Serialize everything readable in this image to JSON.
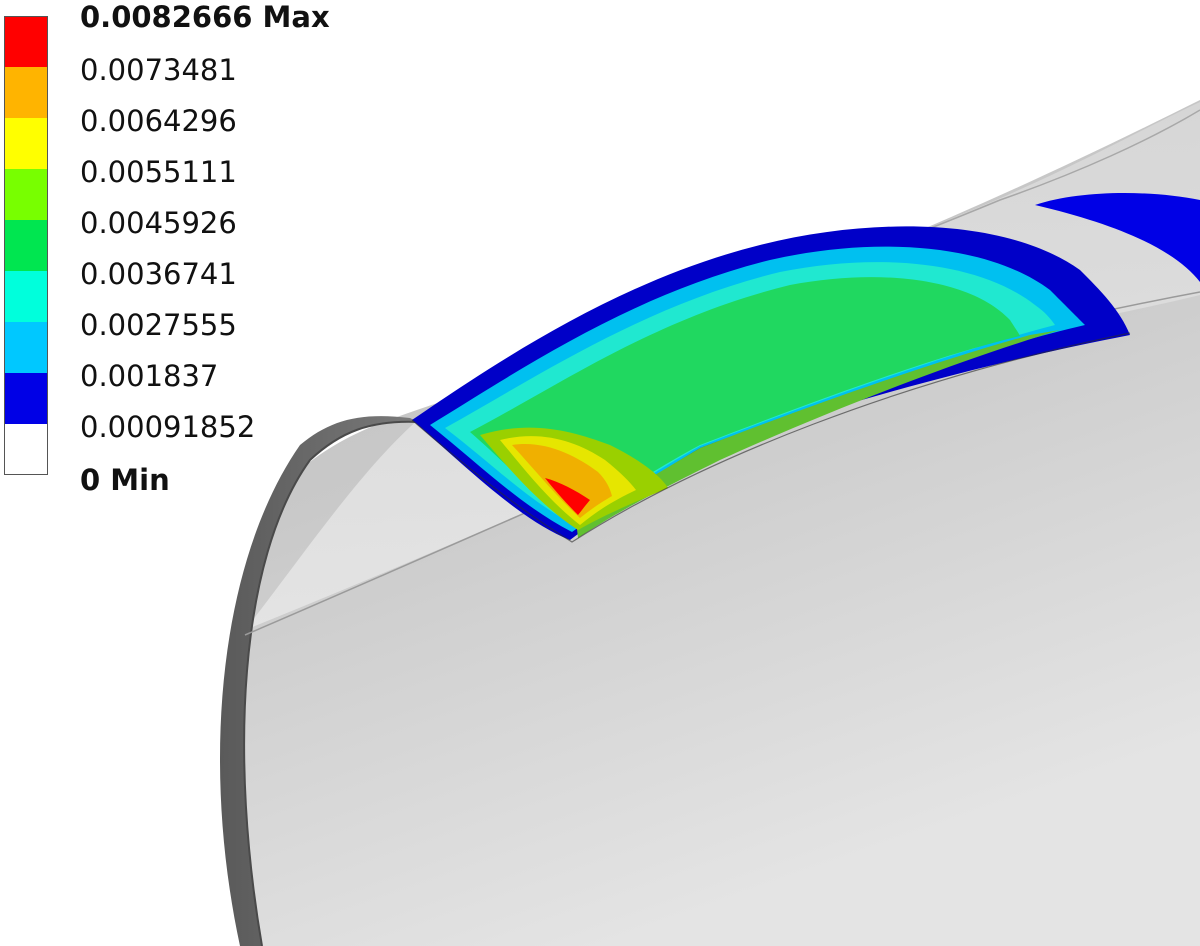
{
  "legend": {
    "max_label": "0.0082666 Max",
    "min_label": "0 Min",
    "levels": [
      {
        "value": "0.0073481",
        "color": "#ff0000"
      },
      {
        "value": "0.0064296",
        "color": "#ffb400"
      },
      {
        "value": "0.0055111",
        "color": "#ffff00"
      },
      {
        "value": "0.0045926",
        "color": "#78ff00"
      },
      {
        "value": "0.0036741",
        "color": "#00e650"
      },
      {
        "value": "0.0027555",
        "color": "#00ffdc"
      },
      {
        "value": "0.001837",
        "color": "#00c8ff"
      },
      {
        "value": "0.00091852",
        "color": "#0000e6"
      },
      {
        "value": "",
        "color": "#ffffff"
      }
    ]
  },
  "colors": {
    "pipe_light": "#dcdcdc",
    "pipe_dark": "#6e6e6e",
    "background": "#ffffff"
  }
}
